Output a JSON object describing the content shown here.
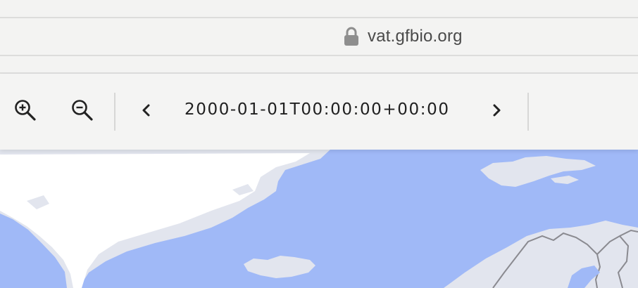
{
  "browser": {
    "url": "vat.gfbio.org",
    "secure_icon": "lock-icon"
  },
  "toolbar": {
    "zoom_in_icon": "zoom-in-icon",
    "zoom_out_icon": "zoom-out-icon",
    "prev_icon": "chevron-left-icon",
    "next_icon": "chevron-right-icon",
    "time": "2000-01-01T00:00:00+00:00"
  },
  "map": {
    "ocean_color": "#a0b9f7",
    "land_color": "#e2e5ee",
    "ice_color": "#ffffff",
    "border_color": "#8a8a90"
  }
}
